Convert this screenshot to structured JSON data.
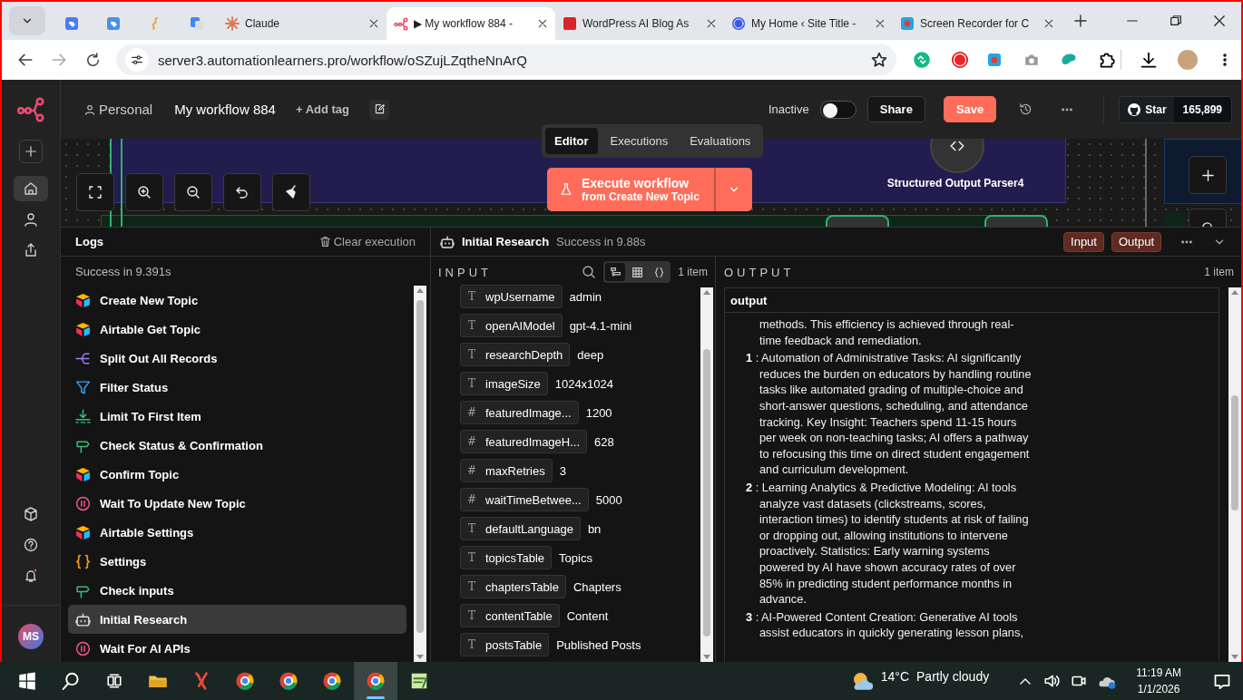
{
  "browser": {
    "tabs": [
      {
        "kind": "pinned",
        "selected": false
      },
      {
        "kind": "pinned",
        "selected": false
      },
      {
        "kind": "pinned",
        "selected": false
      },
      {
        "kind": "pinned",
        "selected": false
      },
      {
        "kind": "page",
        "title": "Claude",
        "selected": false
      },
      {
        "kind": "page",
        "title": "▶ My workflow 884 -",
        "selected": true
      },
      {
        "kind": "page",
        "title": "WordPress AI Blog As",
        "selected": false
      },
      {
        "kind": "page",
        "title": "My Home ‹ Site Title -",
        "selected": false
      },
      {
        "kind": "page",
        "title": "Screen Recorder for C",
        "selected": false
      }
    ],
    "url": "server3.automationlearners.pro/workflow/oSZujLZqtheNnArQ"
  },
  "rail": {
    "nav": [
      {
        "selected": true
      },
      {
        "selected": false
      },
      {
        "selected": false
      }
    ],
    "avatar": "MS"
  },
  "header": {
    "project": "Personal",
    "workflow_name": "My workflow 884",
    "add_tag": "+ Add tag",
    "status_label": "Inactive",
    "active": false,
    "share": "Share",
    "save": "Save",
    "star": "Star",
    "star_count": "165,899"
  },
  "view_tabs": [
    {
      "label": "Editor",
      "selected": true
    },
    {
      "label": "Executions",
      "selected": false
    },
    {
      "label": "Evaluations",
      "selected": false
    }
  ],
  "execute": {
    "title": "Execute workflow",
    "subtitle": "from Create New Topic"
  },
  "canvas_nodes": [
    {
      "label": "Structured Output Parser4"
    }
  ],
  "logs": {
    "title": "Logs",
    "clear": "Clear execution",
    "summary": "Success in 9.391s",
    "items": [
      {
        "kind": "airtable",
        "label": "Create New Topic",
        "selected": false
      },
      {
        "kind": "airtable",
        "label": "Airtable Get Topic",
        "selected": false
      },
      {
        "kind": "split",
        "label": "Split Out All Records",
        "selected": false
      },
      {
        "kind": "filter",
        "label": "Filter Status",
        "selected": false
      },
      {
        "kind": "limit",
        "label": "Limit To First Item",
        "selected": false
      },
      {
        "kind": "if",
        "label": "Check Status & Confirmation",
        "selected": false
      },
      {
        "kind": "airtable",
        "label": "Confirm Topic",
        "selected": false
      },
      {
        "kind": "wait",
        "label": "Wait To Update New Topic",
        "selected": false
      },
      {
        "kind": "airtable",
        "label": "Airtable Settings",
        "selected": false
      },
      {
        "kind": "code",
        "label": "Settings",
        "selected": false
      },
      {
        "kind": "if",
        "label": "Check inputs",
        "selected": false
      },
      {
        "kind": "agent",
        "label": "Initial Research",
        "selected": true
      },
      {
        "kind": "wait",
        "label": "Wait For AI APIs",
        "selected": false
      }
    ]
  },
  "detail": {
    "node": "Initial Research",
    "status": "Success in 9.88s",
    "input_button": "Input",
    "output_button": "Output"
  },
  "input": {
    "title": "INPUT",
    "count": "1 item",
    "view_modes": [
      {
        "selected": true
      },
      {
        "selected": false
      },
      {
        "selected": false
      }
    ],
    "fields": [
      {
        "type": "T",
        "name": "wpUsername",
        "value": "admin"
      },
      {
        "type": "T",
        "name": "openAIModel",
        "value": "gpt-4.1-mini"
      },
      {
        "type": "T",
        "name": "researchDepth",
        "value": "deep"
      },
      {
        "type": "T",
        "name": "imageSize",
        "value": "1024x1024"
      },
      {
        "type": "#",
        "name": "featuredImage...",
        "value": "1200"
      },
      {
        "type": "#",
        "name": "featuredImageH...",
        "value": "628"
      },
      {
        "type": "#",
        "name": "maxRetries",
        "value": "3"
      },
      {
        "type": "#",
        "name": "waitTimeBetwee...",
        "value": "5000"
      },
      {
        "type": "T",
        "name": "defaultLanguage",
        "value": "bn"
      },
      {
        "type": "T",
        "name": "topicsTable",
        "value": "Topics"
      },
      {
        "type": "T",
        "name": "chaptersTable",
        "value": "Chapters"
      },
      {
        "type": "T",
        "name": "contentTable",
        "value": "Content"
      },
      {
        "type": "T",
        "name": "postsTable",
        "value": "Published Posts"
      }
    ]
  },
  "output": {
    "title": "OUTPUT",
    "count": "1 item",
    "field": "output",
    "entries": [
      {
        "kind": "continuation",
        "text": "methods. This efficiency is achieved through real-time feedback and remediation."
      },
      {
        "kind": "item",
        "text": "**1** : Automation of Administrative Tasks: AI significantly reduces the burden on educators by handling routine tasks like automated grading of multiple-choice and short-answer questions, scheduling, and attendance tracking. Key Insight: Teachers spend 11-15 hours per week on non-teaching tasks; AI offers a pathway to refocusing this time on direct student engagement and curriculum development."
      },
      {
        "kind": "item",
        "text": "**2** : Learning Analytics & Predictive Modeling: AI tools analyze vast datasets (clickstreams, scores, interaction times) to identify students at risk of failing or dropping out, allowing institutions to intervene proactively. Statistics: Early warning systems powered by AI have shown accuracy rates of over 85% in predicting student performance months in advance."
      },
      {
        "kind": "item",
        "text": "**3** : AI-Powered Content Creation: Generative AI tools assist educators in quickly generating lesson plans,"
      }
    ]
  },
  "taskbar": {
    "apps": [
      {
        "selected": false
      },
      {
        "selected": false
      },
      {
        "selected": false
      },
      {
        "selected": false
      },
      {
        "selected": false
      },
      {
        "selected": true
      },
      {
        "selected": false
      }
    ],
    "weather_temp": "14°C",
    "weather_text": "Partly cloudy",
    "time": "11:19 AM",
    "date": "1/1/2026"
  }
}
